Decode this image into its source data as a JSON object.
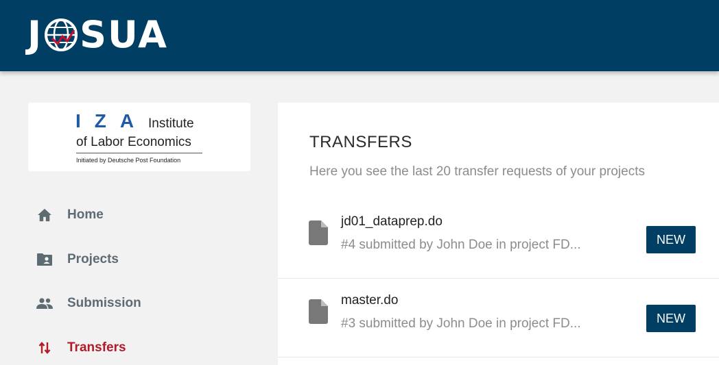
{
  "app": {
    "brand_left": "J",
    "brand_right": "SUA",
    "brand_color": "#003e63"
  },
  "institute": {
    "letters": "IZA",
    "line1": "Institute",
    "line2": "of Labor Economics",
    "line3": "Initiated by Deutsche Post Foundation"
  },
  "sidebar": {
    "items": [
      {
        "label": "Home",
        "icon": "home-icon"
      },
      {
        "label": "Projects",
        "icon": "folder-account-icon"
      },
      {
        "label": "Submission",
        "icon": "people-icon"
      },
      {
        "label": "Transfers",
        "icon": "transfer-arrows-icon",
        "active": true
      }
    ],
    "active_color": "#b31a27"
  },
  "main": {
    "title": "TRANSFERS",
    "subtitle": "Here you see the last 20 transfer requests of your projects",
    "transfers": [
      {
        "filename": "jd01_dataprep.do",
        "meta": "#4 submitted by John Doe in project FD...",
        "status": "NEW",
        "icon": "file-icon"
      },
      {
        "filename": "master.do",
        "meta": "#3 submitted by John Doe in project FD...",
        "status": "NEW",
        "icon": "file-icon"
      }
    ]
  }
}
